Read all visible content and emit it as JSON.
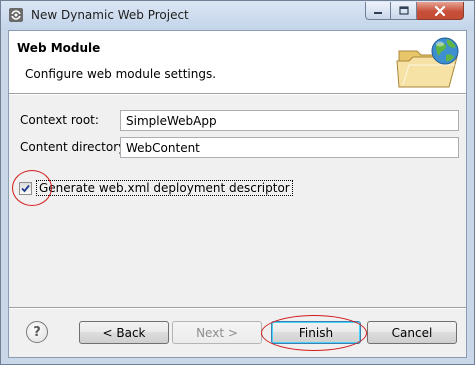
{
  "window": {
    "title": "New Dynamic Web Project"
  },
  "header": {
    "title": "Web Module",
    "description": "Configure web module settings.",
    "icon": "folder-globe-icon"
  },
  "form": {
    "context_root": {
      "label": "Context root:",
      "value": "SimpleWebApp"
    },
    "content_directory": {
      "label": "Content directory:",
      "value": "WebContent"
    },
    "generate_descriptor": {
      "label": "Generate web.xml deployment descriptor",
      "checked": true
    }
  },
  "buttons": {
    "help": "?",
    "back": "< Back",
    "next": "Next >",
    "finish": "Finish",
    "cancel": "Cancel"
  },
  "colors": {
    "annotation": "#d21b1b",
    "close_button": "#c7503a"
  }
}
